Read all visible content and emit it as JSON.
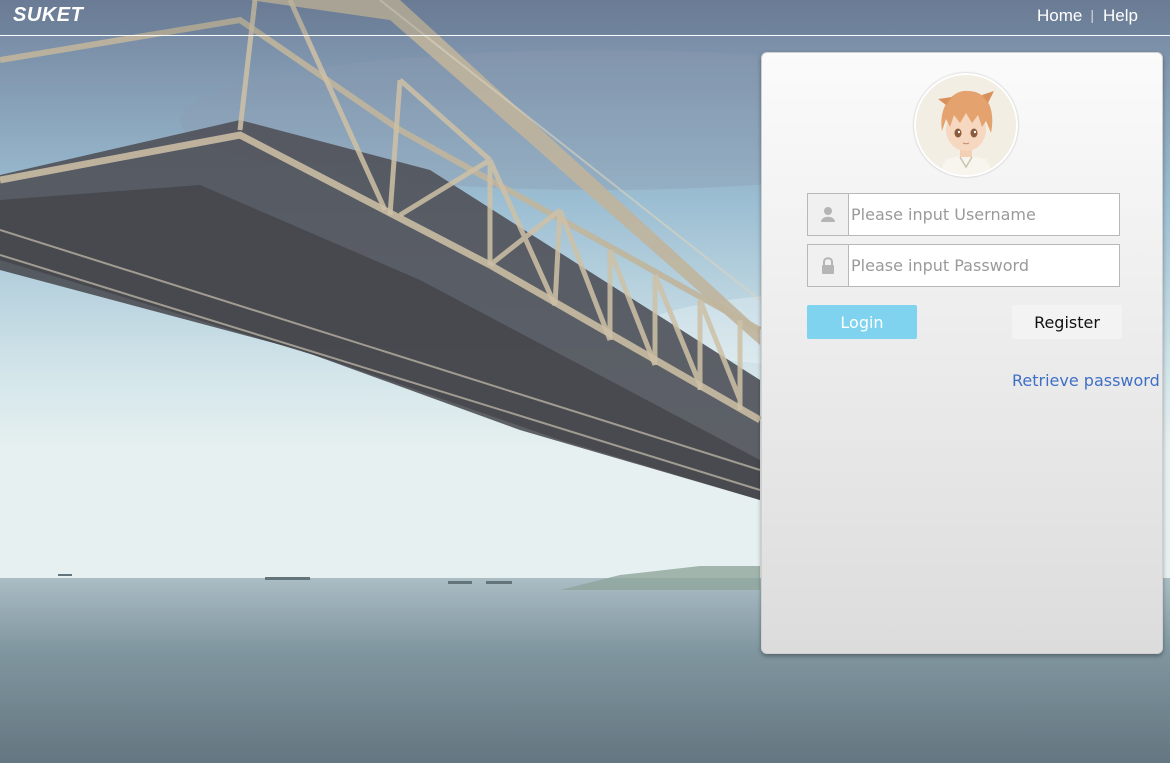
{
  "header": {
    "logo_text": "SUKET",
    "nav": [
      {
        "label": "Home"
      },
      {
        "label": "Help"
      }
    ],
    "nav_separator": "|"
  },
  "login": {
    "username": {
      "value": "",
      "placeholder": "Please input Username",
      "icon": "user-icon"
    },
    "password": {
      "value": "",
      "placeholder": "Please input Password",
      "icon": "lock-icon"
    },
    "login_label": "Login",
    "register_label": "Register",
    "retrieve_label": "Retrieve password"
  },
  "colors": {
    "login_button": "#7fd3ee",
    "link": "#3f6fc5",
    "panel_top": "#fbfbfb",
    "panel_bottom": "#dcdcdc"
  }
}
